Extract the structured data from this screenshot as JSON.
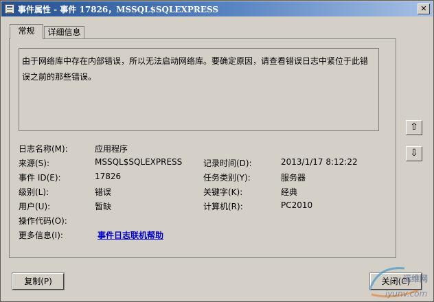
{
  "window": {
    "title": "事件属性 - 事件 17826，MSSQL$SQLEXPRESS",
    "close_glyph": "✕"
  },
  "tabs": [
    {
      "label": "常规"
    },
    {
      "label": "详细信息"
    }
  ],
  "description": "由于网络库中存在内部错误，所以无法启动网络库。要确定原因，请查看错误日志中紧位于此错误之前的那些错误。",
  "fields": {
    "log_name": {
      "label": "日志名称(M):",
      "value": "应用程序"
    },
    "source": {
      "label": "来源(S):",
      "value": "MSSQL$SQLEXPRESS"
    },
    "logged": {
      "label": "记录时间(D):",
      "value": "2013/1/17 8:12:22"
    },
    "event_id": {
      "label": "事件 ID(E):",
      "value": "17826"
    },
    "task_category": {
      "label": "任务类别(Y):",
      "value": "服务器"
    },
    "level": {
      "label": "级别(L):",
      "value": "错误"
    },
    "keywords": {
      "label": "关键字(K):",
      "value": "经典"
    },
    "user": {
      "label": "用户(U):",
      "value": "暂缺"
    },
    "computer": {
      "label": "计算机(R):",
      "value": "PC2010"
    },
    "opcode": {
      "label": "操作代码(O):",
      "value": ""
    },
    "more_info": {
      "label": "更多信息(I):",
      "link": "事件日志联机帮助"
    }
  },
  "nav": {
    "up_glyph": "⇧",
    "down_glyph": "⇩"
  },
  "buttons": {
    "copy": "复制(P)",
    "close": "关闭(C)"
  },
  "watermark": {
    "line1": "运维网",
    "line2": "iyunv.com"
  },
  "colors": {
    "title_gradient_start": "#244f8f",
    "title_gradient_end": "#a6c0e4",
    "link": "#0000c8",
    "face": "#d4d0c8"
  }
}
